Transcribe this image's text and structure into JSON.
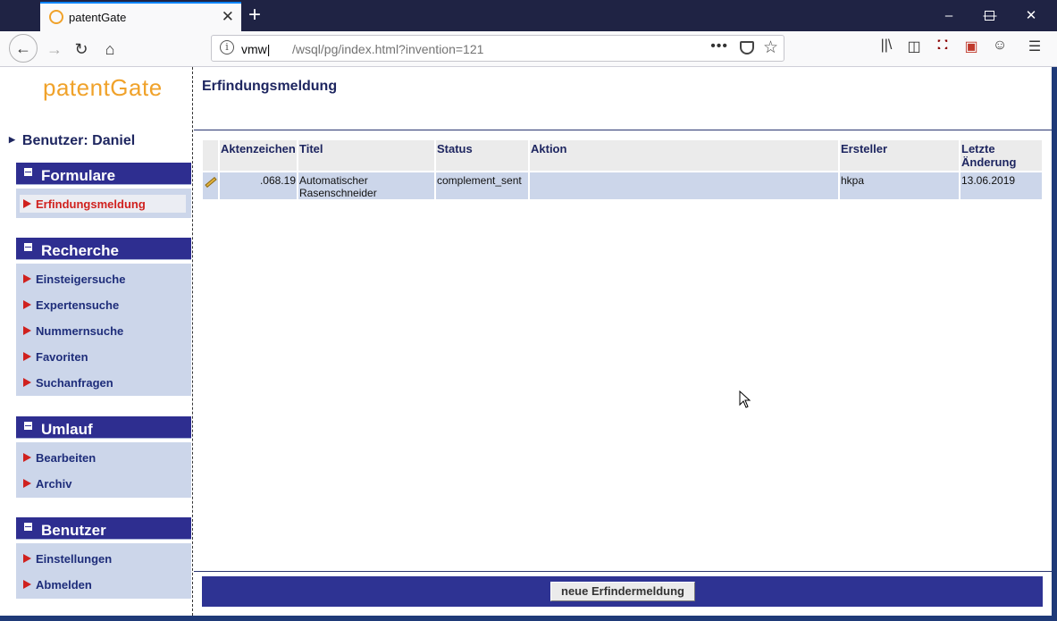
{
  "browser": {
    "tab_title": "patentGate",
    "url_host": "vmw|",
    "url_path": "/wsql/pg/index.html?invention=121"
  },
  "sidebar": {
    "logo": "patentGate",
    "user_label": "Benutzer: Daniel",
    "sections": [
      {
        "title": "Formulare",
        "items": [
          "Erfindungsmeldung"
        ]
      },
      {
        "title": "Recherche",
        "items": [
          "Einsteigersuche",
          "Expertensuche",
          "Nummernsuche",
          "Favoriten",
          "Suchanfragen"
        ]
      },
      {
        "title": "Umlauf",
        "items": [
          "Bearbeiten",
          "Archiv"
        ]
      },
      {
        "title": "Benutzer",
        "items": [
          "Einstellungen",
          "Abmelden"
        ]
      }
    ]
  },
  "main": {
    "title": "Erfindungsmeldung",
    "table": {
      "headers": [
        "Aktenzeichen",
        "Titel",
        "Status",
        "Aktion",
        "Ersteller",
        "Letzte Änderung"
      ],
      "rows": [
        {
          "aktenzeichen": ".068.19",
          "titel": "Automatischer Rasenschneider",
          "status": "complement_sent",
          "aktion": "",
          "ersteller": "hkpa",
          "letzte_aenderung": "13.06.2019"
        }
      ]
    },
    "new_button": "neue Erfindermeldung"
  }
}
